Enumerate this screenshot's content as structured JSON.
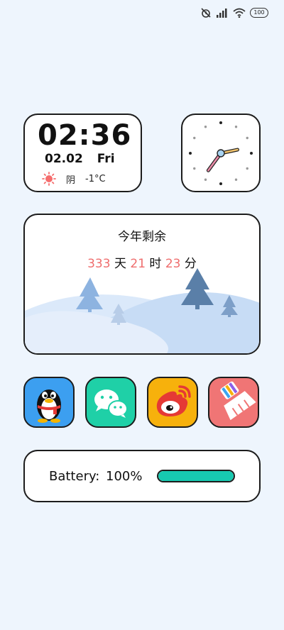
{
  "status_bar": {
    "battery_level": "100",
    "icons": [
      "alarm-off-icon",
      "signal-icon",
      "wifi-icon",
      "battery-icon"
    ]
  },
  "clock_widget": {
    "time": "02:36",
    "date": "02.02",
    "weekday": "Fri",
    "weather_icon": "sun-icon",
    "weather_condition": "阴",
    "temperature": "-1°C"
  },
  "analog_clock": {
    "hour": 2,
    "minute": 36,
    "hour_hand_color": "#f2c46d",
    "minute_hand_color": "#e88aa6",
    "center_color": "#a8d3f1"
  },
  "countdown_widget": {
    "title": "今年剩余",
    "days": "333",
    "days_unit": "天",
    "hours": "21",
    "hours_unit": "时",
    "minutes": "23",
    "minutes_unit": "分",
    "number_color": "#ef6d6d"
  },
  "apps": [
    {
      "name": "qq",
      "icon": "qq-penguin-icon",
      "color": "#3c9ff0"
    },
    {
      "name": "wechat",
      "icon": "wechat-icon",
      "color": "#1fd0a7"
    },
    {
      "name": "weibo",
      "icon": "weibo-icon",
      "color": "#f7b10c"
    },
    {
      "name": "cleaner",
      "icon": "broom-icon",
      "color": "#f07575"
    }
  ],
  "battery_widget": {
    "label": "Battery:",
    "value": "100%",
    "level": 1.0,
    "fill_color": "#17c9b0"
  }
}
